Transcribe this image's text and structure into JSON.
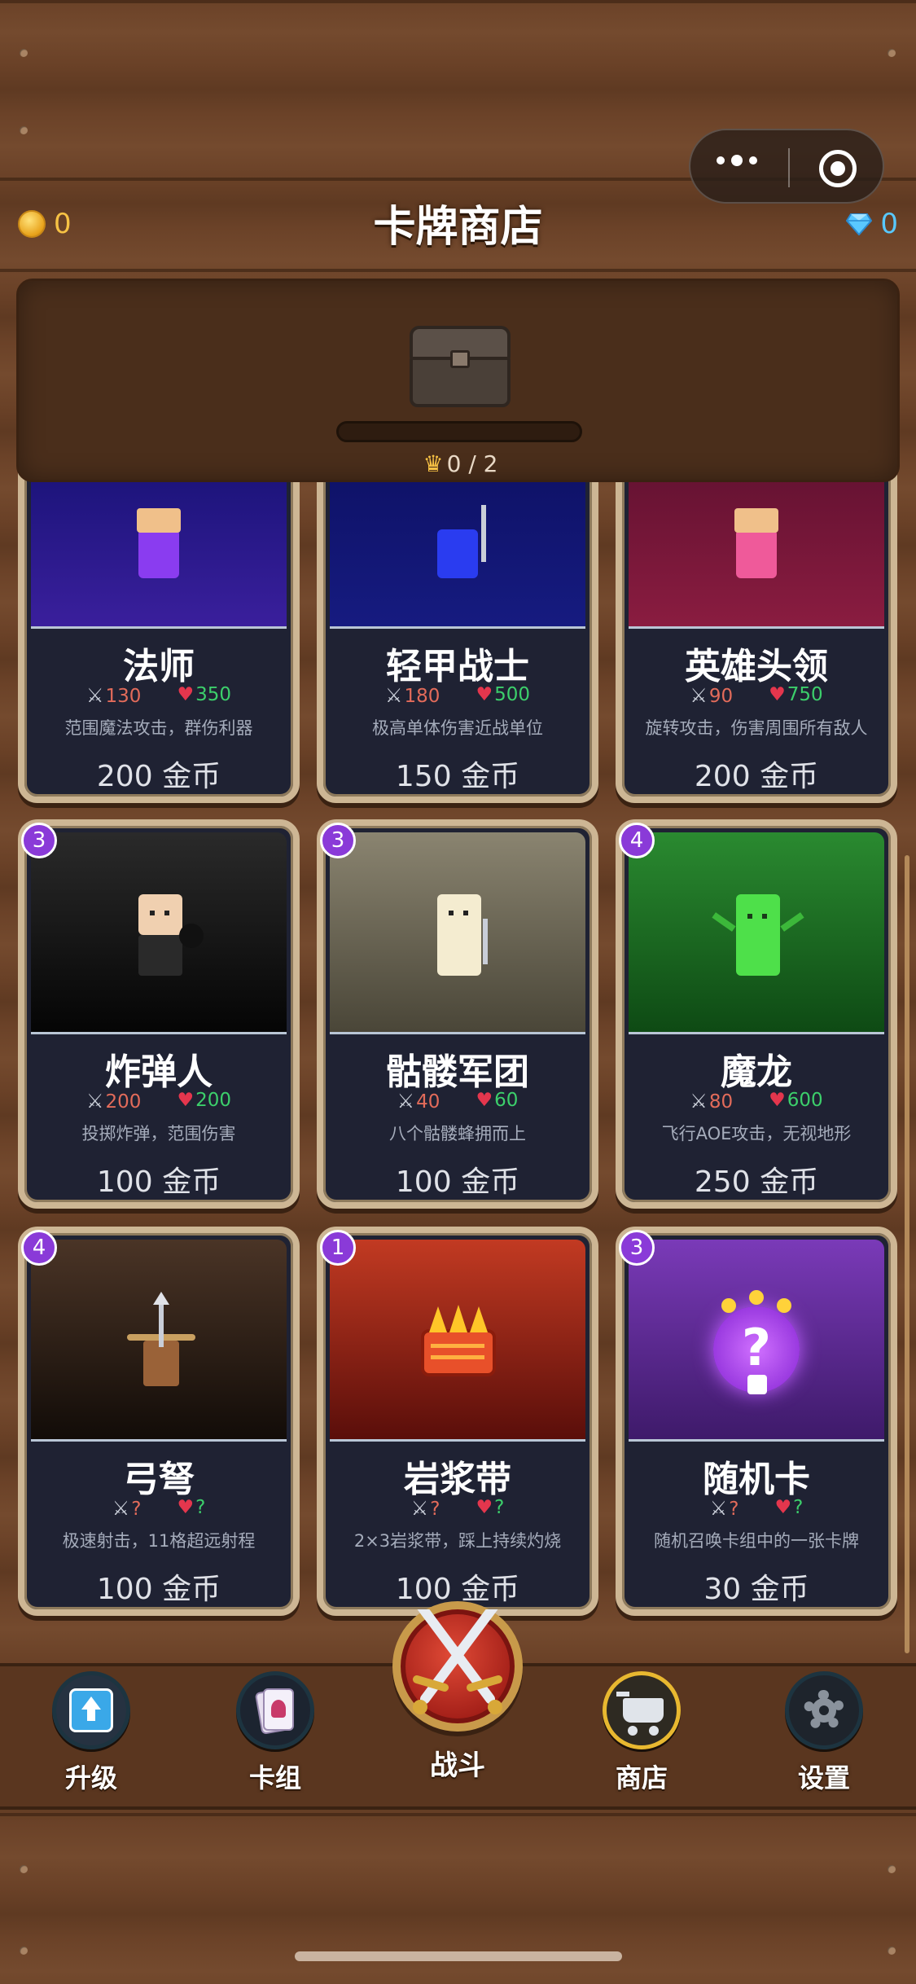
{
  "header": {
    "title": "卡牌商店",
    "gold": "0",
    "gems": "0"
  },
  "chest": {
    "crowns_text": "0 / 2",
    "progress": 0
  },
  "cards": [
    {
      "name": "法师",
      "attack": "130",
      "hp": "350",
      "desc": "范围魔法攻击，群伤利器",
      "price": "200 金币",
      "color": "#3a1f9c"
    },
    {
      "name": "轻甲战士",
      "attack": "180",
      "hp": "500",
      "desc": "极高单体伤害近战单位",
      "price": "150 金币",
      "color": "#161b80"
    },
    {
      "name": "英雄头领",
      "attack": "90",
      "hp": "750",
      "desc": "旋转攻击，伤害周围所有敌人",
      "price": "200 金币",
      "color": "#8a1c40"
    },
    {
      "name": "炸弹人",
      "attack": "200",
      "hp": "200",
      "desc": "投掷炸弹，范围伤害",
      "price": "100 金币",
      "cost": "3",
      "color": "#141414"
    },
    {
      "name": "骷髅军团",
      "attack": "40",
      "hp": "60",
      "desc": "八个骷髅蜂拥而上",
      "price": "100 金币",
      "cost": "3",
      "color": "#706a5a"
    },
    {
      "name": "魔龙",
      "attack": "80",
      "hp": "600",
      "desc": "飞行AOE攻击，无视地形",
      "price": "250 金币",
      "cost": "4",
      "color": "#1f7a28"
    },
    {
      "name": "弓弩",
      "attack": "?",
      "hp": "?",
      "desc": "极速射击，11格超远射程",
      "price": "100 金币",
      "cost": "4",
      "color": "#2e2018"
    },
    {
      "name": "岩浆带",
      "attack": "?",
      "hp": "?",
      "desc": "2×3岩浆带，踩上持续灼烧",
      "price": "100 金币",
      "cost": "1",
      "color": "#9c2418"
    },
    {
      "name": "随机卡",
      "attack": "?",
      "hp": "?",
      "desc": "随机召唤卡组中的一张卡牌",
      "price": "30 金币",
      "cost": "3",
      "color": "#5e2a9a"
    }
  ],
  "nav": {
    "upgrade": "升级",
    "deck": "卡组",
    "battle": "战斗",
    "shop": "商店",
    "settings": "设置"
  },
  "icons": {
    "gold": "coin-icon",
    "gem": "diamond-icon",
    "crown": "crown-icon",
    "attack": "crossed-swords-icon",
    "hp": "heart-icon"
  }
}
